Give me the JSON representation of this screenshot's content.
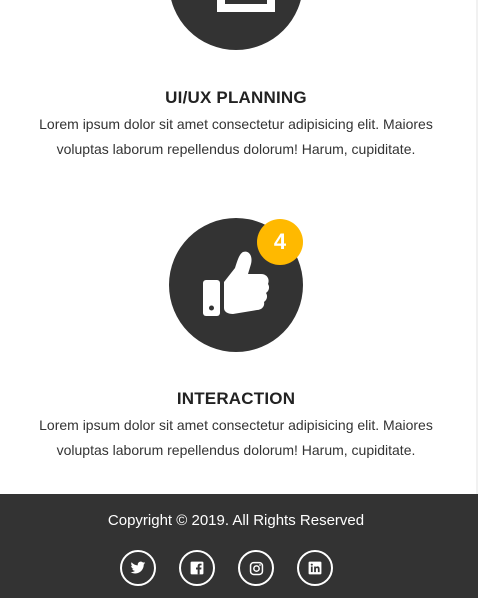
{
  "features": [
    {
      "icon": "desk-icon",
      "title": "UI/UX PLANNING",
      "text_line1": "Lorem ipsum dolor sit amet consectetur adipisicing elit. Maiores",
      "text_line2": "voluptas laborum repellendus dolorum! Harum, cupiditate."
    },
    {
      "icon": "thumbs-up-icon",
      "badge": "4",
      "title": "INTERACTION",
      "text_line1": "Lorem ipsum dolor sit amet consectetur adipisicing elit. Maiores",
      "text_line2": "voluptas laborum repellendus dolorum! Harum, cupiditate."
    }
  ],
  "footer": {
    "copyright": "Copyright © 2019. All Rights Reserved",
    "social": [
      "twitter-icon",
      "facebook-icon",
      "instagram-icon",
      "linkedin-icon"
    ]
  },
  "colors": {
    "dark": "#333333",
    "accent": "#ffb900",
    "white": "#ffffff"
  }
}
